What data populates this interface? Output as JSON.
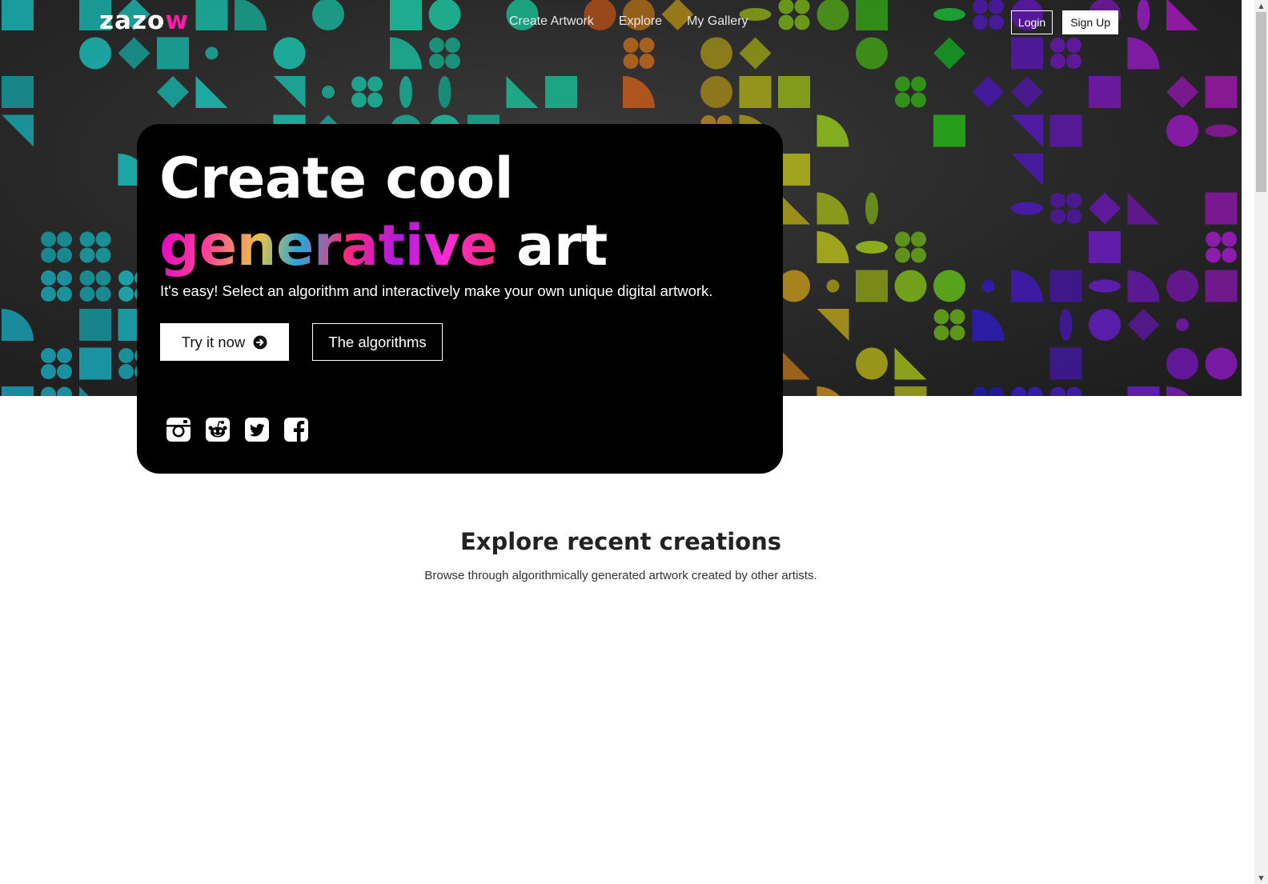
{
  "brand": {
    "logo_main": "zazo",
    "logo_accent": "w"
  },
  "nav": {
    "links": [
      "Create Artwork",
      "Explore",
      "My Gallery"
    ],
    "login": "Login",
    "signup": "Sign Up"
  },
  "hero": {
    "headline_line1": "Create cool",
    "headline_gen": "generative",
    "headline_art": "art",
    "tagline": "It's easy! Select an algorithm and interactively make your own unique digital artwork.",
    "try_label": "Try it now",
    "algos_label": "The algorithms",
    "social_icons": [
      "instagram-icon",
      "reddit-icon",
      "twitter-icon",
      "facebook-icon"
    ]
  },
  "explore": {
    "title": "Explore recent creations",
    "subtitle": "Browse through algorithmically generated artwork created by other artists."
  },
  "colors": {
    "accent_pink": "#ff1aa8",
    "card_bg": "#000000",
    "hero_bg": "#262626"
  }
}
